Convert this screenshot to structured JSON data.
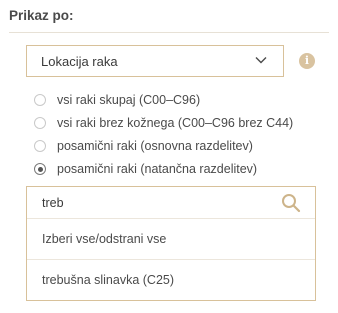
{
  "heading": "Prikaz po:",
  "select": {
    "value": "Lokacija raka",
    "icon": "chevron-down-icon"
  },
  "info_icon": "info-icon",
  "radio_options": [
    {
      "label": "vsi raki skupaj (C00–C96)",
      "checked": false
    },
    {
      "label": "vsi raki brez kožnega (C00–C96 brez C44)",
      "checked": false
    },
    {
      "label": "posamični raki (osnovna razdelitev)",
      "checked": false
    },
    {
      "label": "posamični raki (natančna razdelitev)",
      "checked": true
    }
  ],
  "search": {
    "value": "treb",
    "icon": "search-icon"
  },
  "list": {
    "select_all_label": "Izberi vse/odstrani vse",
    "items": [
      "trebušna slinavka (C25)"
    ]
  },
  "colors": {
    "accent_border": "#d8c19a",
    "info_icon": "#d9c3a0",
    "search_icon": "#cdb48a"
  }
}
